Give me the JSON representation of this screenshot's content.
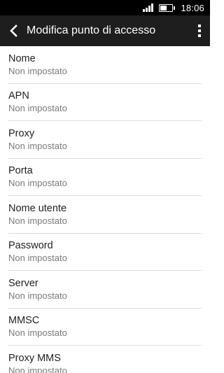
{
  "status_bar": {
    "time": "18:06",
    "signal_icon": "signal-icon",
    "battery_icon": "battery-icon"
  },
  "action_bar": {
    "title": "Modifica punto di accesso",
    "back_icon": "back-arrow-icon",
    "menu_icon": "overflow-menu-icon"
  },
  "settings": [
    {
      "label": "Nome",
      "value": "Non impostato"
    },
    {
      "label": "APN",
      "value": "Non impostato"
    },
    {
      "label": "Proxy",
      "value": "Non impostato"
    },
    {
      "label": "Porta",
      "value": "Non impostato"
    },
    {
      "label": "Nome utente",
      "value": "Non impostato"
    },
    {
      "label": "Password",
      "value": "Non impostato"
    },
    {
      "label": "Server",
      "value": "Non impostato"
    },
    {
      "label": "MMSC",
      "value": "Non impostato"
    },
    {
      "label": "Proxy MMS",
      "value": "Non impostato"
    }
  ],
  "colors": {
    "status_bar_bg": "#000000",
    "action_bar_bg": "#1e1e1e",
    "divider": "#dcdcdc",
    "secondary_text": "#7a7a7a"
  }
}
